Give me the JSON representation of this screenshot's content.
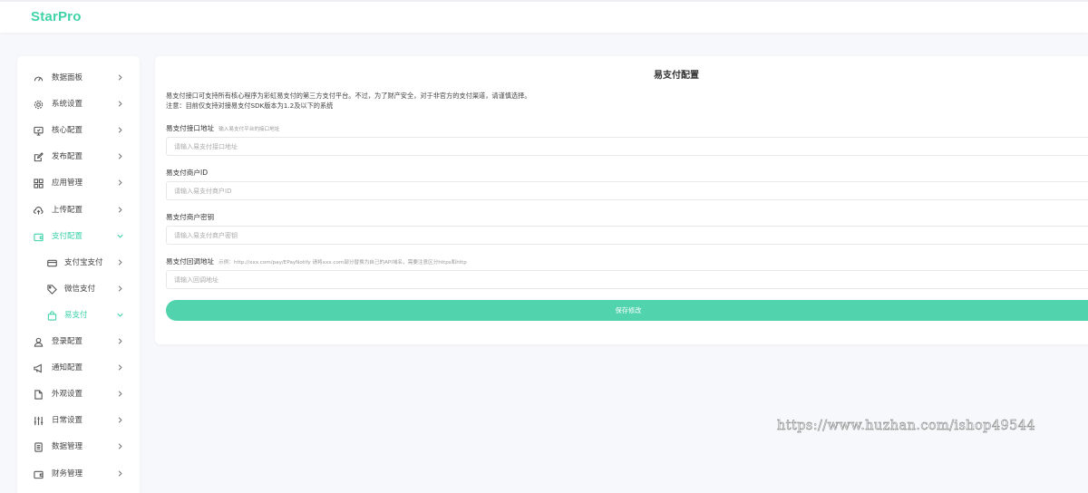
{
  "app": {
    "logo": "StarPro"
  },
  "sidebar": {
    "items": [
      {
        "label": "数据面板",
        "icon": "gauge-icon",
        "chevron": "chevron-right-icon"
      },
      {
        "label": "系统设置",
        "icon": "gear-icon",
        "chevron": "chevron-right-icon"
      },
      {
        "label": "核心配置",
        "icon": "monitor-icon",
        "chevron": "chevron-right-icon"
      },
      {
        "label": "发布配置",
        "icon": "edit-icon",
        "chevron": "chevron-right-icon"
      },
      {
        "label": "应用管理",
        "icon": "apps-grid-icon",
        "chevron": "chevron-right-icon"
      },
      {
        "label": "上传配置",
        "icon": "cloud-upload-icon",
        "chevron": "chevron-right-icon"
      },
      {
        "label": "支付配置",
        "icon": "wallet-icon",
        "chevron": "chevron-down-icon",
        "expanded": true,
        "children": [
          {
            "label": "支付宝支付",
            "icon": "card-icon",
            "chevron": "chevron-right-icon"
          },
          {
            "label": "微信支付",
            "icon": "tag-icon",
            "chevron": "chevron-right-icon"
          },
          {
            "label": "易支付",
            "icon": "bag-icon",
            "chevron": "chevron-down-icon",
            "active": true
          }
        ]
      },
      {
        "label": "登录配置",
        "icon": "user-icon",
        "chevron": "chevron-right-icon"
      },
      {
        "label": "通知配置",
        "icon": "megaphone-icon",
        "chevron": "chevron-right-icon"
      },
      {
        "label": "外观设置",
        "icon": "file-icon",
        "chevron": "chevron-right-icon"
      },
      {
        "label": "日常设置",
        "icon": "sliders-icon",
        "chevron": "chevron-right-icon"
      },
      {
        "label": "数据管理",
        "icon": "document-icon",
        "chevron": "chevron-right-icon"
      },
      {
        "label": "财务管理",
        "icon": "wallet-icon",
        "chevron": "chevron-right-icon"
      }
    ]
  },
  "panel": {
    "title": "易支付配置",
    "intro_line1": "易支付接口可支持所有核心程序为彩虹易支付的第三方支付平台。不过，为了财产安全，对于非官方的支付渠道，请谨慎选择。",
    "intro_line2": "注意：目前仅支持对接易支付SDK版本为1.2及以下的系统",
    "fields": [
      {
        "label": "易支付接口地址",
        "hint": "输入易支付平台的接口地址",
        "placeholder": "请输入易支付接口地址",
        "value": ""
      },
      {
        "label": "易支付商户ID",
        "hint": "",
        "placeholder": "请输入易支付商户ID",
        "value": ""
      },
      {
        "label": "易支付商户密钥",
        "hint": "",
        "placeholder": "请输入易支付商户密钥",
        "value": ""
      },
      {
        "label": "易支付回调地址",
        "hint": "示例：http://xxx.com/pay/EPayNotify 请将xxx.com部分替换为自己的API域名，需要注意区分https和http",
        "placeholder": "请输入回调地址",
        "value": ""
      }
    ],
    "save_label": "保存修改"
  },
  "watermark": "https://www.huzhan.com/ishop49544",
  "colors": {
    "accent": "#3fd2a8",
    "button": "#51d3ad",
    "background": "#f7f8fb"
  }
}
